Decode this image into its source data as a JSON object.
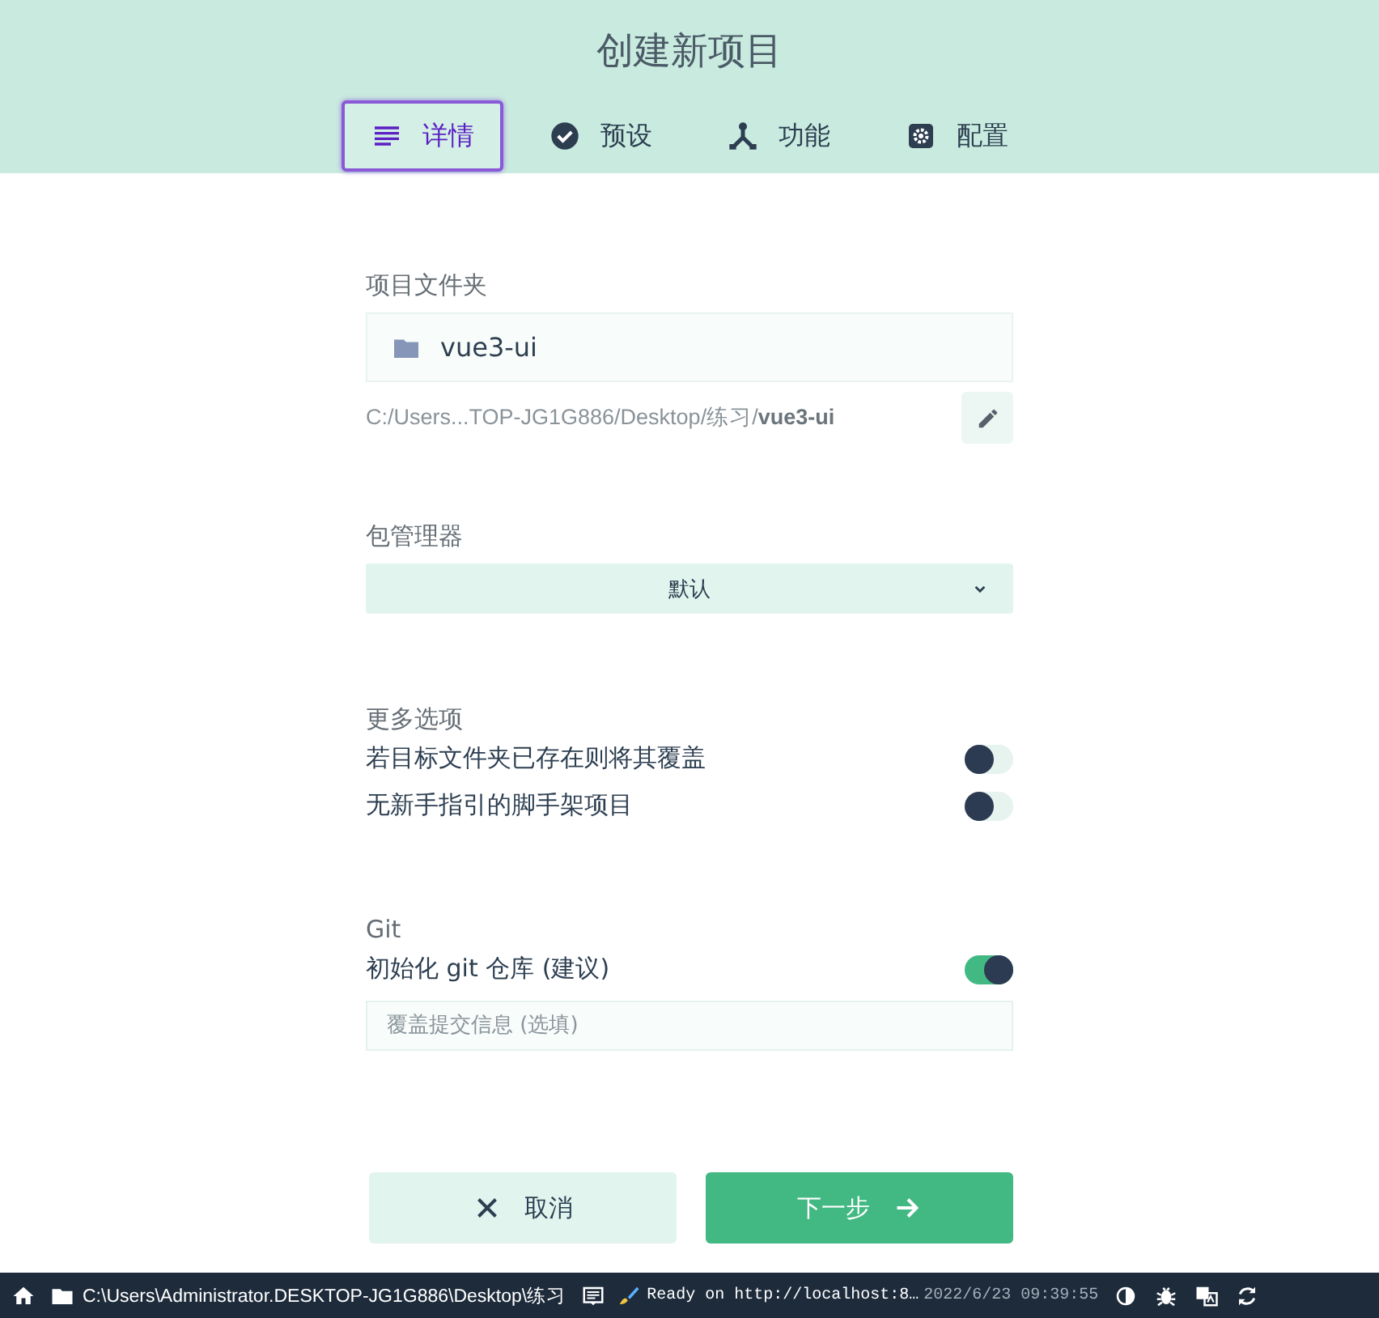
{
  "header": {
    "title": "创建新项目"
  },
  "tabs": [
    {
      "label": "详情",
      "kind": "list",
      "selected": true
    },
    {
      "label": "预设",
      "kind": "check",
      "selected": false
    },
    {
      "label": "功能",
      "kind": "fork",
      "selected": false
    },
    {
      "label": "配置",
      "kind": "gear",
      "selected": false
    }
  ],
  "folder": {
    "label": "项目文件夹",
    "value": "vue3-ui",
    "path": "C:/Users...TOP-JG1G886/Desktop/练习/**vue3-ui**"
  },
  "package_manager": {
    "label": "包管理器",
    "value": "默认"
  },
  "more_options": {
    "label": "更多选项",
    "options": [
      {
        "label": "若目标文件夹已存在则将其覆盖",
        "on": false
      },
      {
        "label": "无新手指引的脚手架项目",
        "on": false
      }
    ]
  },
  "git": {
    "label": "Git",
    "options": [
      {
        "label": "初始化 git 仓库 (建议)",
        "on": true
      }
    ],
    "commit": {
      "placeholder": "覆盖提交信息 (选填)"
    }
  },
  "buttons": [
    {
      "label": "取消",
      "kind": "cancel"
    },
    {
      "label": "下一步",
      "kind": "next"
    }
  ],
  "status_bar": {
    "path": "C:\\Users\\Administrator.DESKTOP-JG1G886\\Desktop\\练习",
    "log": "Ready on http://localhost:8…",
    "time": "2022/6/23 09:39:55"
  }
}
